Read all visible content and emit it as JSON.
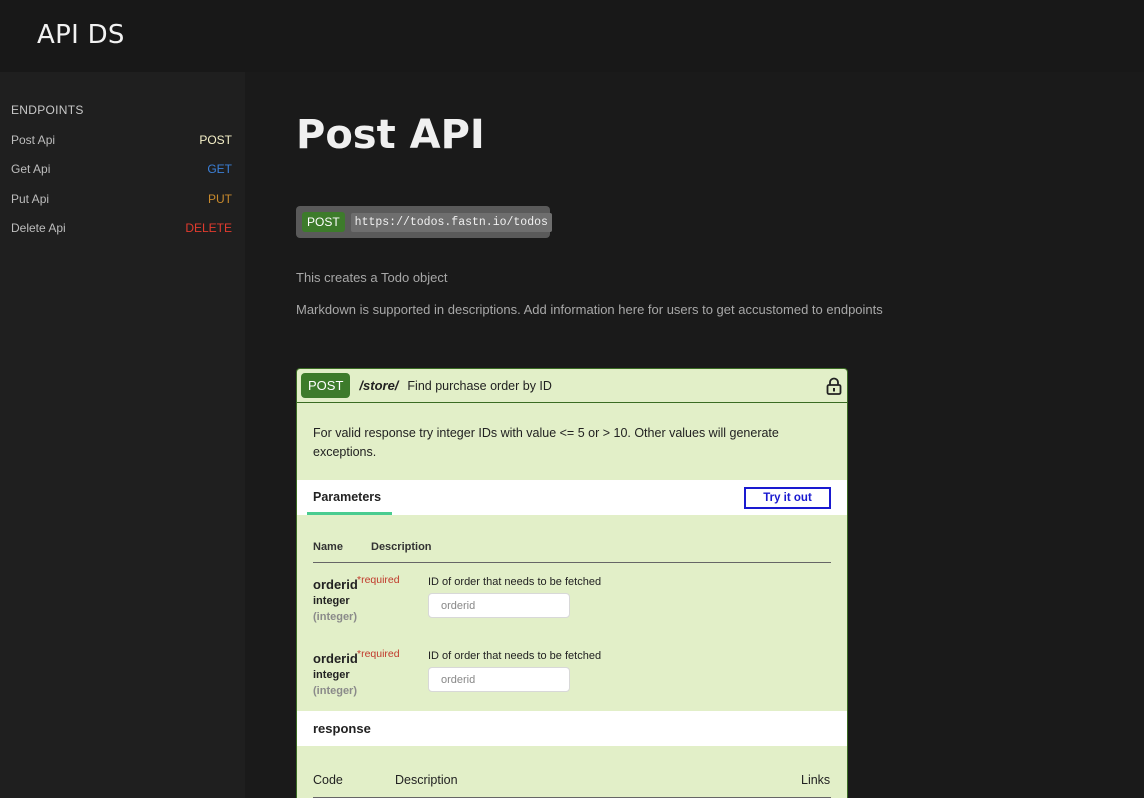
{
  "app": {
    "title": "API DS"
  },
  "sidebar": {
    "heading": "ENDPOINTS",
    "items": [
      {
        "label": "Post Api",
        "method": "POST"
      },
      {
        "label": "Get Api",
        "method": "GET"
      },
      {
        "label": "Put Api",
        "method": "PUT"
      },
      {
        "label": "Delete Api",
        "method": "DELETE"
      }
    ]
  },
  "page": {
    "title": "Post API",
    "endpoint": {
      "method": "POST",
      "url": "https://todos.fastn.io/todos"
    },
    "description_1": "This creates a Todo object",
    "description_2": "Markdown is supported in descriptions. Add information here for users to get accustomed to endpoints"
  },
  "operation": {
    "method": "POST",
    "path": "/store/",
    "summary": "Find purchase order by ID",
    "description": "For valid response try integer IDs with value <= 5 or > 10. Other values will generate exceptions.",
    "parameters_tab": "Parameters",
    "try_it_out": "Try it out",
    "columns": {
      "name": "Name",
      "description": "Description"
    },
    "params": [
      {
        "name": "orderid",
        "required": "*required",
        "type": "integer",
        "format": "(integer)",
        "description": "ID of order that needs to be fetched",
        "placeholder": "orderid"
      },
      {
        "name": "orderid",
        "required": "*required",
        "type": "integer",
        "format": "(integer)",
        "description": "ID of order that needs to be fetched",
        "placeholder": "orderid"
      }
    ],
    "response_title": "response",
    "response_columns": {
      "code": "Code",
      "description": "Description",
      "links": "Links"
    }
  },
  "colors": {
    "post": "#3d7b2b",
    "get": "#3b7fd6",
    "put": "#c88a2c",
    "delete": "#e23b2e",
    "card_bg": "#e2efc8",
    "try_button": "#1a1ad0"
  }
}
